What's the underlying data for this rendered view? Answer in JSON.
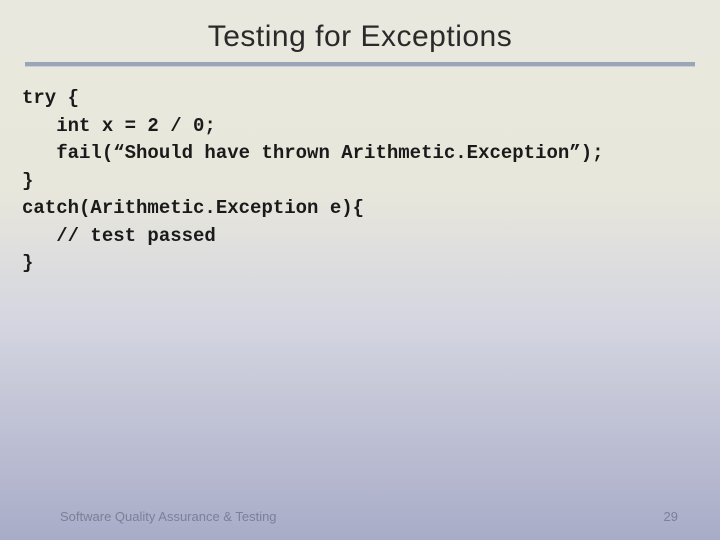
{
  "slide": {
    "title": "Testing for Exceptions",
    "code": "try {\n   int x = 2 / 0;\n   fail(“Should have thrown Arithmetic.Exception”);\n}\ncatch(Arithmetic.Exception e){\n   // test passed\n}",
    "footer_text": "Software Quality Assurance & Testing",
    "page_number": "29"
  }
}
